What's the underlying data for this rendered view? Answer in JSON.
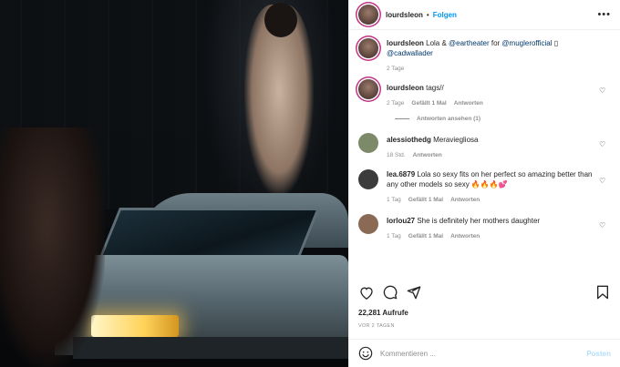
{
  "post": {
    "username": "lourdsleon",
    "follow_label": "Folgen",
    "separator": "•",
    "more_icon": "more-options-icon"
  },
  "caption": {
    "username": "lourdsleon",
    "text_1": " Lola & ",
    "mention_1": "@eartheater",
    "text_2": " for ",
    "mention_2": "@muglerofficial",
    "text_3": " ▯",
    "mention_3": "@cadwallader",
    "time": "2 Tage"
  },
  "comments": [
    {
      "username": "lourdsleon",
      "text": " tags//",
      "time": "2 Tage",
      "likes": "Gefällt 1 Mal",
      "reply": "Antworten",
      "view_replies": "Antworten ansehen (1)",
      "avatar_color": "#6b4a3e"
    },
    {
      "username": "alessiothedg",
      "text": " Meraviegliosa",
      "time": "18 Std.",
      "reply": "Antworten",
      "avatar_color": "#7c8a6a"
    },
    {
      "username": "lea.6879",
      "text": " Lola so sexy fits on her perfect so amazing better than any other models so sexy 🔥🔥🔥💕",
      "time": "1 Tag",
      "likes": "Gefällt 1 Mal",
      "reply": "Antworten",
      "avatar_color": "#3b3b3b"
    },
    {
      "username": "lorlou27",
      "text": " She is definitely her mothers daughter",
      "time": "1 Tag",
      "likes": "Gefällt 1 Mal",
      "reply": "Antworten",
      "avatar_color": "#8a6a55"
    }
  ],
  "actions": {
    "like_icon": "heart-icon",
    "comment_icon": "comment-icon",
    "share_icon": "share-icon",
    "save_icon": "bookmark-icon"
  },
  "likes_count": "22,281 Aufrufe",
  "post_date": "VOR 2 TAGEN",
  "add_comment": {
    "placeholder": "Kommentieren ...",
    "post_label": "Posten"
  },
  "colors": {
    "link": "#0095f6",
    "mention": "#00376b",
    "muted": "#8e8e8e",
    "post_disabled": "#b2dffc"
  }
}
